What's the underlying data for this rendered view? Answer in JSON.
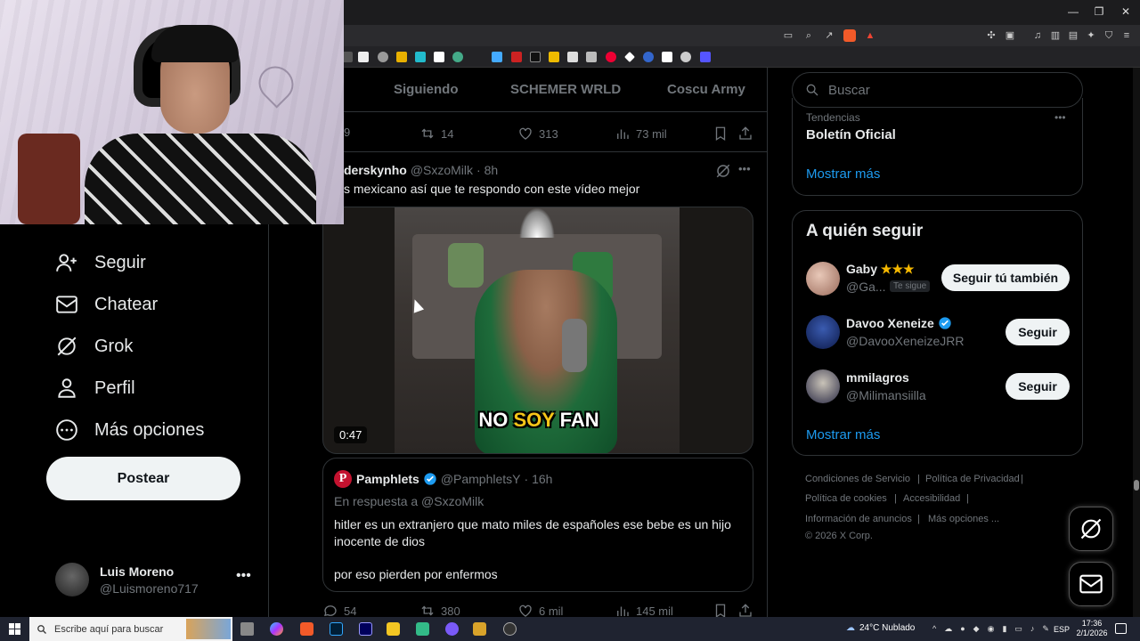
{
  "taskbar": {
    "search_placeholder": "Escribe aquí para buscar",
    "weather": "24°C  Nublado",
    "lang": "ESP",
    "time": "17:36",
    "date": "2/1/2026"
  },
  "main": {
    "tabs": [
      "Siguiendo",
      "SCHEMER WRLD",
      "Coscu Army"
    ],
    "prev_tweet_actions": {
      "replies": "9",
      "retweets": "14",
      "likes": "313",
      "views": "73 mil"
    },
    "tweet": {
      "author_name": "derskynho",
      "handle": "@SxzoMilk",
      "time": "· 8h",
      "text": "s mexicano así que te respondo con este vídeo mejor",
      "video_duration": "0:47",
      "video_caption_a": "NO ",
      "video_caption_b": "SOY",
      "video_caption_c": " FAN"
    },
    "quote": {
      "author_name": "Pamphlets",
      "handle": "@PamphletsY",
      "time": "· 16h",
      "reply_to": "En respuesta a @SxzoMilk",
      "text_line1": "hitler es un extranjero que mato miles de españoles ese bebe es un hijo",
      "text_line2": "inocente de dios",
      "text_line3": "por eso pierden por enfermos"
    },
    "tweet_actions": {
      "replies": "54",
      "retweets": "380",
      "likes": "6 mil",
      "views": "145 mil"
    }
  },
  "nav": {
    "items": [
      {
        "label": "Seguir",
        "icon": "follow-icon"
      },
      {
        "label": "Chatear",
        "icon": "mail-icon"
      },
      {
        "label": "Grok",
        "icon": "grok-icon"
      },
      {
        "label": "Perfil",
        "icon": "profile-icon"
      },
      {
        "label": "Más opciones",
        "icon": "more-circle-icon"
      }
    ],
    "post_button": "Postear",
    "account": {
      "name": "Luis Moreno",
      "handle": "@Luismoreno717"
    }
  },
  "right": {
    "search_placeholder": "Buscar",
    "trends": {
      "category": "Tendencias",
      "title": "Boletín Oficial",
      "show_more": "Mostrar más"
    },
    "who_to_follow": {
      "title": "A quién seguir",
      "users": [
        {
          "name": "Gaby",
          "stars": "★★★",
          "handle": "@Ga...",
          "badge": "Te sigue",
          "button": "Seguir tú también"
        },
        {
          "name": "Davoo Xeneize",
          "handle": "@DavooXeneizeJRR",
          "button": "Seguir"
        },
        {
          "name": "mmilagros",
          "handle": "@Milimansiilla",
          "button": "Seguir"
        }
      ],
      "show_more": "Mostrar más"
    },
    "footer": {
      "links": [
        "Condiciones de Servicio",
        "Política de Privacidad",
        "Política de cookies",
        "Accesibilidad",
        "Información de anuncios",
        "Más opciones ..."
      ],
      "copyright": "© 2026 X Corp."
    }
  },
  "colors": {
    "accent": "#1d9bf0",
    "bg": "#000000",
    "muted": "#71767b",
    "text": "#e7e9ea"
  }
}
